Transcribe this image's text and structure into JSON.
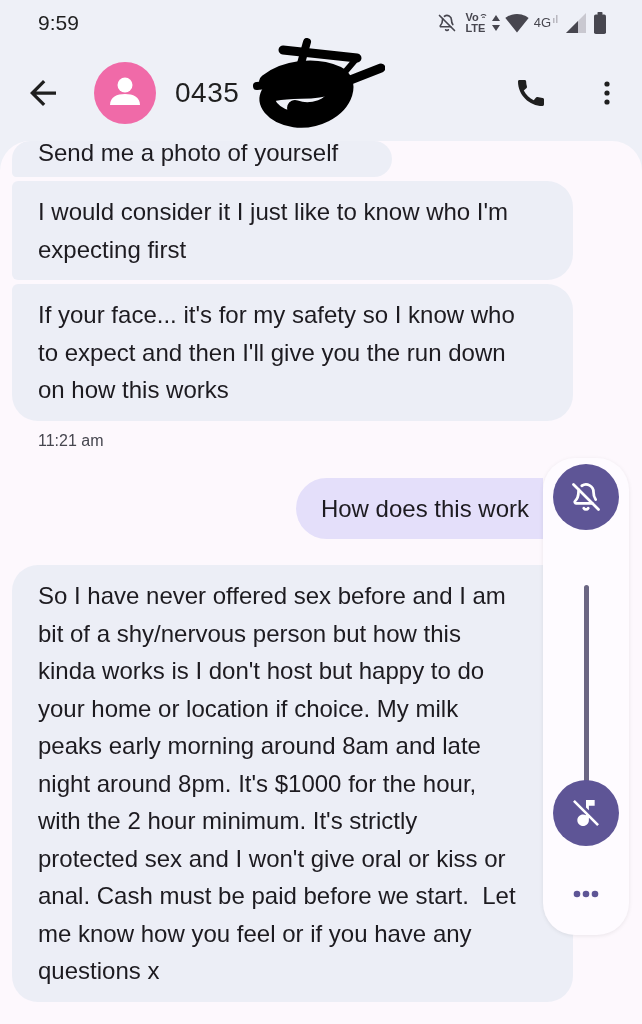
{
  "status_bar": {
    "time": "9:59",
    "volte_top": "Vo",
    "volte_bottom": "LTE",
    "network": "4G"
  },
  "header": {
    "title": "0435"
  },
  "messages": [
    {
      "kind": "incoming",
      "text": "Send me a photo of yourself"
    },
    {
      "kind": "incoming",
      "text": "I would consider it I just like to know who I'm expecting first"
    },
    {
      "kind": "incoming",
      "text": "If your face... it's for my safety so I know who to expect and then I'll give you the run down on how this works"
    },
    {
      "kind": "timestamp",
      "text": "11:21 am"
    },
    {
      "kind": "outgoing",
      "text": "How does this work"
    },
    {
      "kind": "incoming",
      "text": "So I have never offered sex before and I am bit of a shy/nervous person but how this kinda works is I don't host but happy to do your home or location if choice. My milk peaks early morning around 8am and late night around 8pm. It's $1000 for the hour, with the 2 hour minimum. It's strictly protected sex and I won't give oral or kiss or anal. Cash must be paid before we start.  Let me know how you feel or if you have any questions x"
    }
  ],
  "volume_panel": {
    "ringer_muted": true,
    "slider": {
      "muted": true,
      "level": 0
    }
  }
}
